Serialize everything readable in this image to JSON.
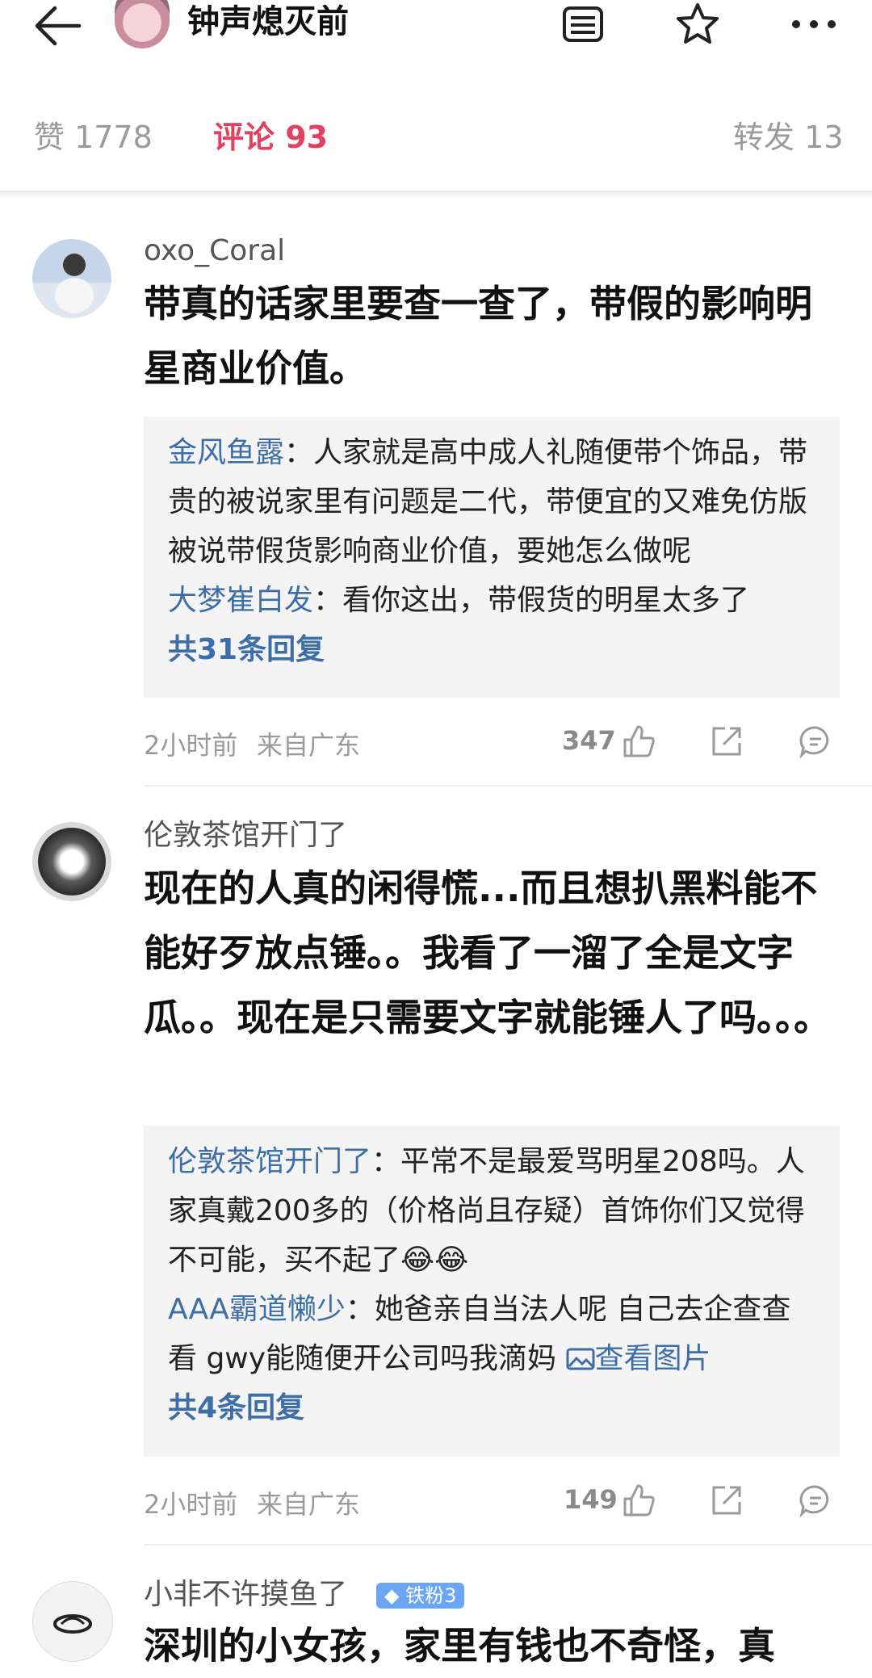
{
  "header": {
    "title": "钟声熄灭前"
  },
  "tabs": {
    "likes": "赞 1778",
    "comments": "评论 93",
    "reposts": "转发 13"
  },
  "comments": [
    {
      "user": "oxo_Coral",
      "text": "带真的话家里要查一查了，带假的影响明星商业价值。",
      "replies": [
        {
          "name": "金风鱼露",
          "sep": "：",
          "text": "人家就是高中成人礼随便带个饰品，带贵的被说家里有问题是二代，带便宜的又难免仿版被说带假货影响商业价值，要她怎么做呢"
        },
        {
          "name": "大梦崔白发",
          "sep": "：",
          "text": "看你这出，带假货的明星太多了"
        }
      ],
      "reply_count": "共31条回复",
      "time": "2小时前",
      "location": "来自广东",
      "likes": "347"
    },
    {
      "user": "伦敦茶馆开门了",
      "text": "现在的人真的闲得慌...而且想扒黑料能不能好歹放点锤。。我看了一溜了全是文字瓜。。现在是只需要文字就能锤人了吗。。。",
      "replies": [
        {
          "name": "伦敦茶馆开门了",
          "sep": "：",
          "text": "平常不是最爱骂明星208吗。人家真戴200多的（价格尚且存疑）首饰你们又觉得不可能，买不起了😂😂"
        },
        {
          "name": "AAA霸道懒少",
          "sep": "：",
          "text": "她爸亲自当法人呢 自己去企查查看 gwy能随便开公司吗我滴妈 ",
          "link": "查看图片"
        }
      ],
      "reply_count": "共4条回复",
      "time": "2小时前",
      "location": "来自广东",
      "likes": "149"
    },
    {
      "user": "小非不许摸鱼了",
      "badge": "铁粉3",
      "text": "深圳的小女孩，家里有钱也不奇怪，真"
    }
  ]
}
